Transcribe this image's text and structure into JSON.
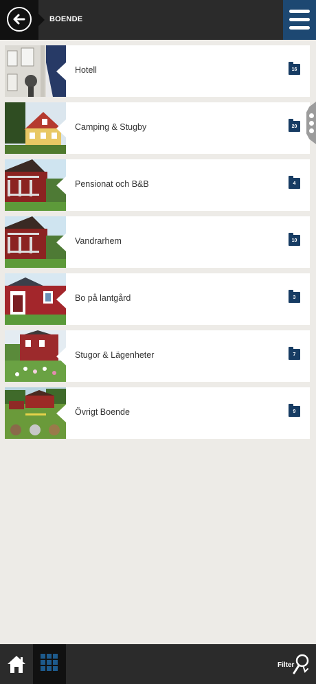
{
  "header": {
    "title": "BOENDE",
    "back_icon": "arrow-left-icon",
    "menu_icon": "hamburger-menu-icon"
  },
  "categories": [
    {
      "label": "Hotell",
      "count": "16",
      "icon": "folder-icon"
    },
    {
      "label": "Camping & Stugby",
      "count": "20",
      "icon": "folder-icon"
    },
    {
      "label": "Pensionat och B&B",
      "count": "4",
      "icon": "folder-icon"
    },
    {
      "label": "Vandrarhem",
      "count": "10",
      "icon": "folder-icon"
    },
    {
      "label": "Bo på lantgård",
      "count": "3",
      "icon": "folder-icon"
    },
    {
      "label": "Stugor & Lägenheter",
      "count": "7",
      "icon": "folder-icon"
    },
    {
      "label": "Övrigt Boende",
      "count": "9",
      "icon": "folder-icon"
    }
  ],
  "footer": {
    "home_icon": "home-icon",
    "grid_icon": "grid-icon",
    "filter_label": "Filter",
    "filter_icon": "filter-search-icon"
  },
  "colors": {
    "header_bg": "#2b2b2b",
    "accent": "#1d4872",
    "badge": "#173c63",
    "page_bg": "#edebe7"
  }
}
